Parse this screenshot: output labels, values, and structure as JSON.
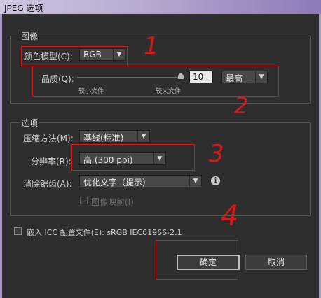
{
  "window": {
    "title": "JPEG 选项"
  },
  "image_group": {
    "title": "图像",
    "color_mode_label": "颜色模型(C):",
    "color_mode_value": "RGB",
    "quality_label": "品质(Q):",
    "quality_value": "10",
    "quality_preset": "最高",
    "slider_min_label": "较小文件",
    "slider_max_label": "较大文件",
    "quality_level": 1.0
  },
  "options_group": {
    "title": "选项",
    "compression_label": "压缩方法(M):",
    "compression_value": "基线(标准)",
    "resolution_label": "分辨率(R):",
    "resolution_value": "高 (300 ppi)",
    "antialias_label": "消除锯齿(A):",
    "antialias_value": "优化文字（提示）",
    "imagemap_label": "图像映射(I)"
  },
  "embed_icc_label": "嵌入 ICC 配置文件(E): sRGB IEC61966-2.1",
  "buttons": {
    "ok": "确定",
    "cancel": "取消"
  },
  "annotations": [
    "1",
    "2",
    "3",
    "4"
  ],
  "icons": {
    "arrow": "▼",
    "info": "i"
  },
  "colors": {
    "annotation": "#d11a1a",
    "title_bar": "#b7a9d1",
    "background": "#2e2e2e"
  }
}
